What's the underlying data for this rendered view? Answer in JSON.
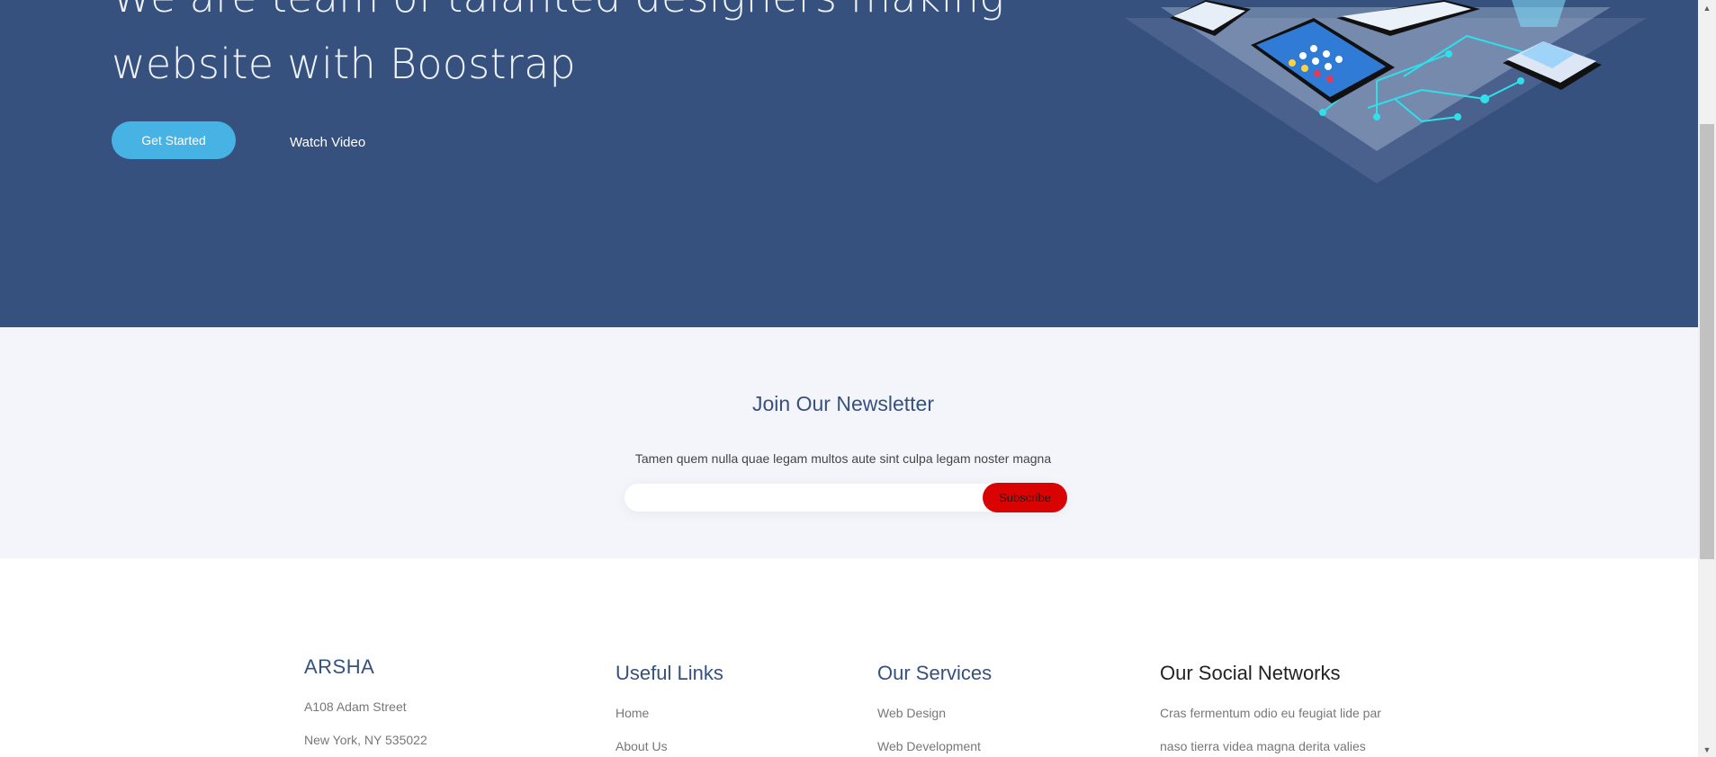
{
  "hero": {
    "title": "We are team of talanted designers making website with Boostrap",
    "primary_button": "Get Started",
    "secondary_button": "Watch Video"
  },
  "newsletter": {
    "title": "Join Our Newsletter",
    "description": "Tamen quem nulla quae legam multos aute sint culpa legam noster magna",
    "email_value": "",
    "submit_label": "Subscribe"
  },
  "footer": {
    "brand": "ARSHA",
    "address_lines": [
      "A108 Adam Street",
      "New York, NY 535022"
    ],
    "useful_links": {
      "title": "Useful Links",
      "items": [
        "Home",
        "About Us"
      ]
    },
    "services": {
      "title": "Our Services",
      "items": [
        "Web Design",
        "Web Development"
      ]
    },
    "social": {
      "title": "Our Social Networks",
      "text_lines": [
        "Cras fermentum odio eu feugiat lide par",
        "naso tierra videa magna derita valies"
      ]
    }
  },
  "colors": {
    "hero_bg": "#37517e",
    "accent": "#47b2e4",
    "subscribe_bg": "#d90303",
    "newsletter_bg": "#f3f5fa"
  },
  "icons": {
    "scroll_up": "scroll-up-arrow-icon",
    "scroll_down": "scroll-down-arrow-icon"
  }
}
